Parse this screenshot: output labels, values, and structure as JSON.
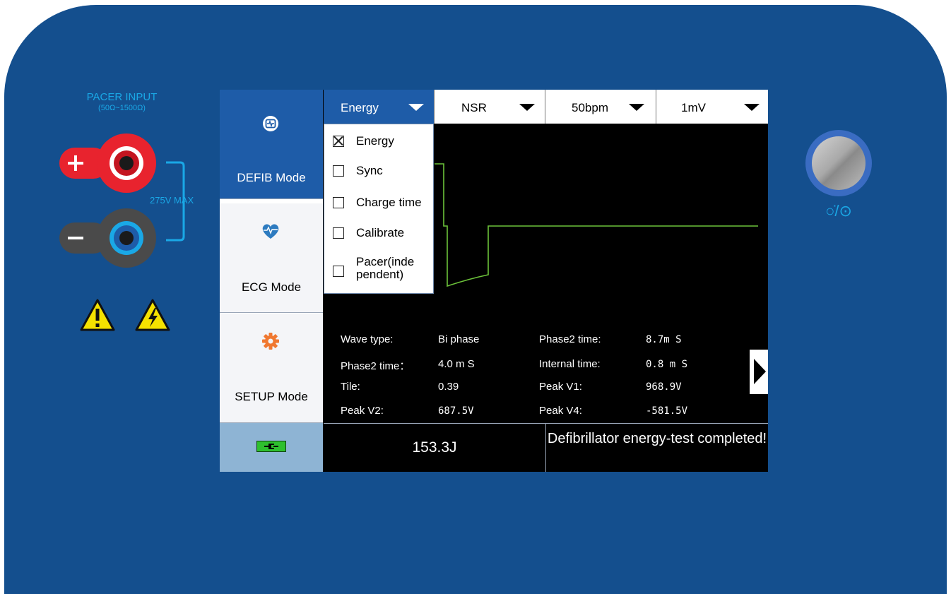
{
  "panel": {
    "pacer_title": "PACER INPUT",
    "pacer_range": "(50Ω~1500Ω)",
    "max_label": "275V MAX",
    "power_label": "○̇/⊙"
  },
  "sidebar": {
    "items": [
      {
        "label": "DEFIB Mode",
        "icon": "defib-monitor-icon",
        "active": true
      },
      {
        "label": "ECG Mode",
        "icon": "heart-pulse-icon",
        "active": false
      },
      {
        "label": "SETUP Mode",
        "icon": "gear-icon",
        "active": false
      }
    ],
    "battery_icon": "battery-plug-icon"
  },
  "dropdowns": [
    {
      "value": "Energy"
    },
    {
      "value": "NSR"
    },
    {
      "value": "50bpm"
    },
    {
      "value": "1mV"
    }
  ],
  "menu": {
    "options": [
      {
        "label": "Energy",
        "checked": true
      },
      {
        "label": "Sync",
        "checked": false
      },
      {
        "label": "Charge time",
        "checked": false
      },
      {
        "label": "Calibrate",
        "checked": false
      },
      {
        "label": "Pacer(inde pendent)",
        "checked": false
      }
    ]
  },
  "readings": {
    "wave_type_label": "Wave type:",
    "wave_type_value": "Bi phase",
    "phase2_time_label_a": "Phase2 time:",
    "phase2_time_value_a": "8.7m S",
    "phase2_time_label_b": "Phase2 time：",
    "phase2_time_value_b": "4.0 m S",
    "internal_time_label": "Internal time:",
    "internal_time_value": "0.8 m S",
    "tile_label": "Tile:",
    "tile_value": "0.39",
    "peak_v1_label": "Peak V1:",
    "peak_v1_value": "968.9V",
    "peak_v2_label": "Peak V2:",
    "peak_v2_value": "687.5V",
    "peak_v4_label": "Peak V4:",
    "peak_v4_value": "-581.5V"
  },
  "footer": {
    "energy": "153.3J",
    "status": "Defibrillator energy-test completed!"
  },
  "colors": {
    "panel": "#144f8e",
    "accent": "#1aa8e6",
    "selected": "#1e5ca8",
    "waveform": "#6cc23a",
    "battery": "#2ec02e"
  }
}
